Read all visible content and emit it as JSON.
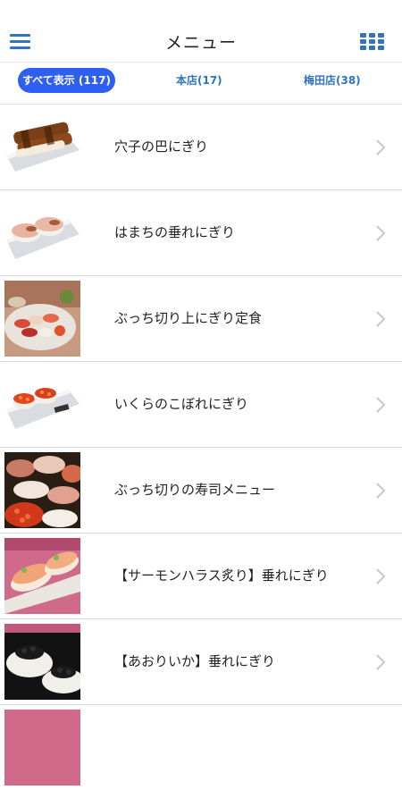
{
  "header": {
    "title": "メニュー",
    "menu_icon": "hamburger-icon",
    "grid_icon": "grid-icon",
    "accent_color": "#2f74c0"
  },
  "filters": [
    {
      "label": "すべて表示 (117)",
      "selected": true
    },
    {
      "label": "本店(17)",
      "selected": false
    },
    {
      "label": "梅田店(38)",
      "selected": false
    }
  ],
  "items": [
    {
      "label": "穴子の巴にぎり"
    },
    {
      "label": "はまちの垂れにぎり"
    },
    {
      "label": "ぶっち切り上にぎり定食"
    },
    {
      "label": "いくらのこぼれにぎり"
    },
    {
      "label": "ぶっち切りの寿司メニュー"
    },
    {
      "label": "【サーモンハラス炙り】垂れにぎり"
    },
    {
      "label": "【あおりいか】垂れにぎり"
    }
  ]
}
